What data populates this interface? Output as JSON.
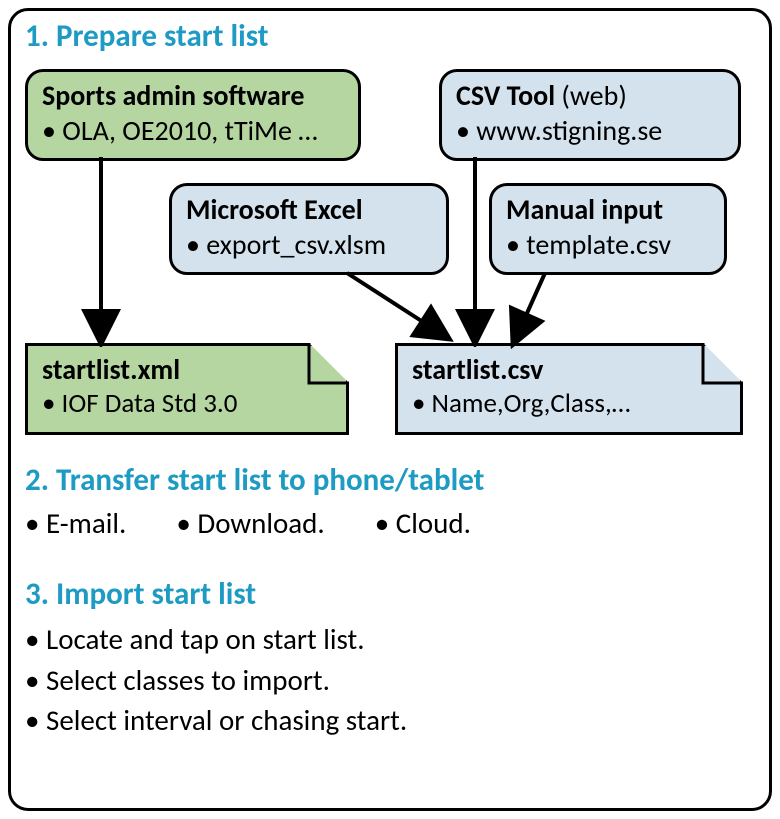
{
  "section1": {
    "heading": "1. Prepare start list",
    "boxes": {
      "sports_admin": {
        "title": "Sports admin software",
        "bullet": "• OLA, OE2010, tTiMe …"
      },
      "csv_tool": {
        "title": "CSV Tool",
        "paren": " (web)",
        "bullet": "• www.stigning.se"
      },
      "excel": {
        "title": "Microsoft Excel",
        "bullet": "• export_csv.xlsm"
      },
      "manual": {
        "title": "Manual input",
        "bullet": "• template.csv"
      }
    },
    "files": {
      "xml": {
        "name": "startlist.xml",
        "bullet": "• IOF Data Std 3.0"
      },
      "csv": {
        "name": "startlist.csv",
        "bullet": "• Name,Org,Class,…"
      }
    }
  },
  "section2": {
    "heading": "2. Transfer start list to phone/tablet",
    "items": [
      "• E-mail.",
      "• Download.",
      "• Cloud."
    ]
  },
  "section3": {
    "heading": "3. Import start list",
    "items": [
      "• Locate and tap on start list.",
      "• Select classes to import.",
      "• Select interval or chasing start."
    ]
  }
}
